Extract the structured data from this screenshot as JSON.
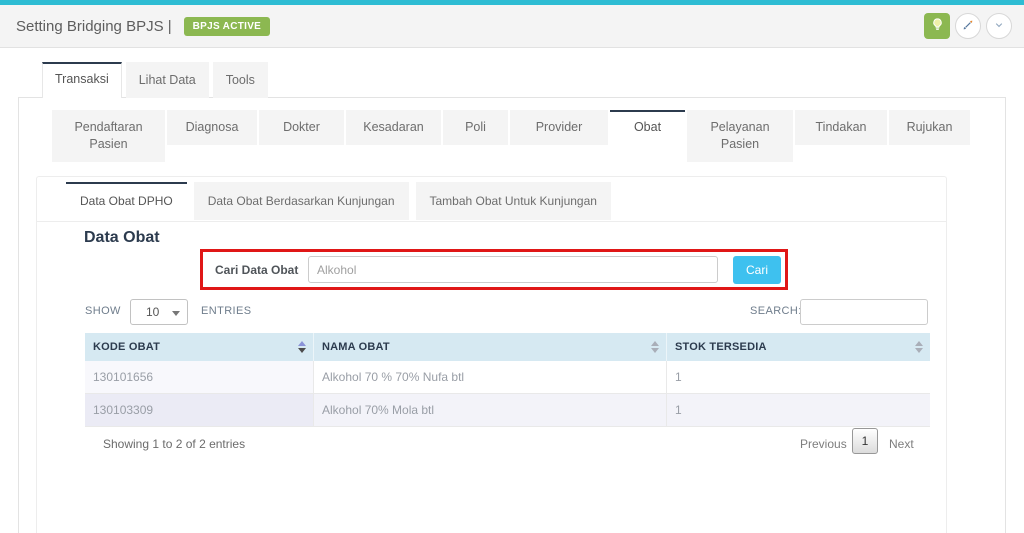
{
  "app": {
    "title": "Setting Bridging BPJS |",
    "status_badge": "BPJS ACTIVE"
  },
  "colors": {
    "top_strip": "#2dbcd3",
    "badge_green": "#8cb851",
    "active_tab_accent": "#2c3b4e",
    "table_header_bg": "#d6e9f2",
    "search_button_blue": "#3ec1ef",
    "highlight_red": "#e01717"
  },
  "main_tabs": [
    {
      "label": "Transaksi",
      "active": true
    },
    {
      "label": "Lihat Data",
      "active": false
    },
    {
      "label": "Tools",
      "active": false
    }
  ],
  "module_tabs": [
    {
      "label": "Pendaftaran Pasien",
      "active": false
    },
    {
      "label": "Diagnosa",
      "active": false
    },
    {
      "label": "Dokter",
      "active": false
    },
    {
      "label": "Kesadaran",
      "active": false
    },
    {
      "label": "Poli",
      "active": false
    },
    {
      "label": "Provider",
      "active": false
    },
    {
      "label": "Obat",
      "active": true
    },
    {
      "label": "Pelayanan Pasien",
      "active": false
    },
    {
      "label": "Tindakan",
      "active": false
    },
    {
      "label": "Rujukan",
      "active": false
    }
  ],
  "obat_tabs": [
    {
      "label": "Data Obat DPHO",
      "active": true
    },
    {
      "label": "Data Obat Berdasarkan Kunjungan",
      "active": false
    },
    {
      "label": "Tambah Obat Untuk Kunjungan",
      "active": false
    }
  ],
  "section": {
    "heading": "Data Obat",
    "search_label": "Cari Data Obat",
    "search_value": "Alkohol",
    "search_button": "Cari"
  },
  "controls": {
    "show_label": "SHOW",
    "page_length": "10",
    "entries_label": "ENTRIES",
    "search_label": "SEARCH:"
  },
  "table": {
    "columns": [
      "KODE OBAT",
      "NAMA OBAT",
      "STOK TERSEDIA"
    ],
    "rows": [
      [
        "130101656",
        "Alkohol 70 % 70% Nufa btl",
        "1"
      ],
      [
        "130103309",
        "Alkohol 70% Mola btl",
        "1"
      ]
    ]
  },
  "footer": {
    "info": "Showing 1 to 2 of 2 entries",
    "previous": "Previous",
    "page": "1",
    "next": "Next"
  }
}
